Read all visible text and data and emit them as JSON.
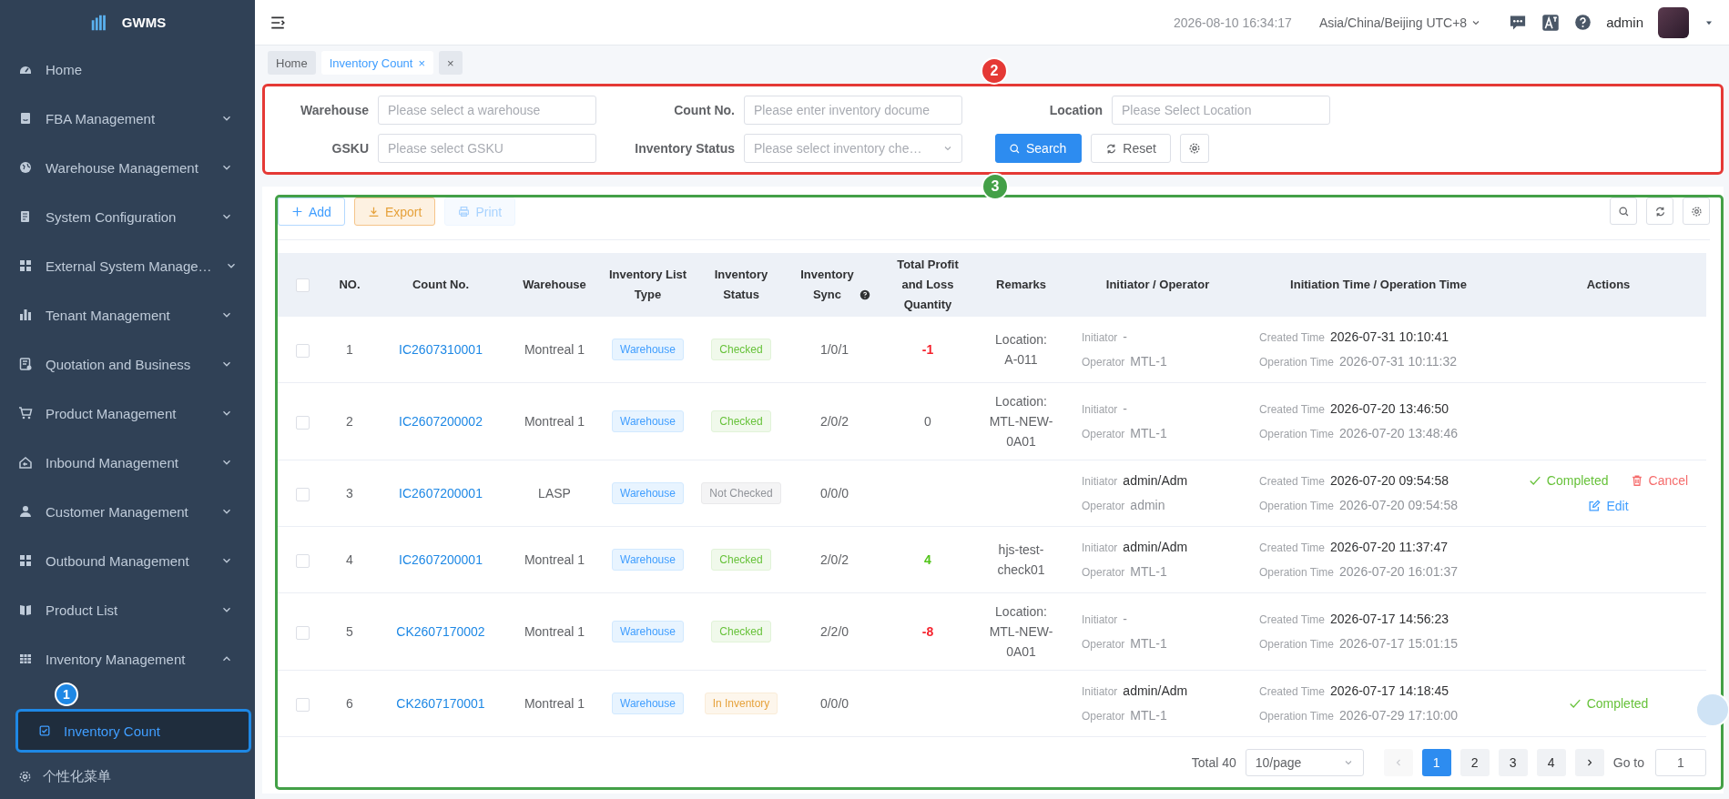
{
  "sidebar": {
    "logo": "GWMS",
    "items": [
      {
        "label": "Home",
        "kind": "link"
      },
      {
        "label": "FBA Management",
        "kind": "submenu",
        "expanded": false
      },
      {
        "label": "Warehouse Management",
        "kind": "submenu",
        "expanded": false
      },
      {
        "label": "System Configuration",
        "kind": "submenu",
        "expanded": false
      },
      {
        "label": "External System Manage…",
        "kind": "submenu",
        "expanded": false
      },
      {
        "label": "Tenant Management",
        "kind": "submenu",
        "expanded": false
      },
      {
        "label": "Quotation and Business",
        "kind": "submenu",
        "expanded": false
      },
      {
        "label": "Product Management",
        "kind": "submenu",
        "expanded": false
      },
      {
        "label": "Inbound Management",
        "kind": "submenu",
        "expanded": false
      },
      {
        "label": "Customer Management",
        "kind": "submenu",
        "expanded": false
      },
      {
        "label": "Outbound Management",
        "kind": "submenu",
        "expanded": false
      },
      {
        "label": "Product List",
        "kind": "submenu",
        "expanded": false
      },
      {
        "label": "Inventory Management",
        "kind": "submenu",
        "expanded": true,
        "children": [
          {
            "label": "Inventory Count",
            "selected": true
          }
        ]
      }
    ],
    "footer": "个性化菜单"
  },
  "header": {
    "datetime": "2026-08-10 16:34:17",
    "timezone": "Asia/China/Beijing UTC+8",
    "user": "admin"
  },
  "tabs": [
    {
      "label": "Home",
      "selected": false,
      "closable": false
    },
    {
      "label": "Inventory Count",
      "selected": true,
      "closable": true
    }
  ],
  "close_all": "×",
  "filters": [
    {
      "label": "Warehouse",
      "kind": "input",
      "placeholder": "Please select a warehouse"
    },
    {
      "label": "Count No.",
      "kind": "input",
      "placeholder": "Please enter inventory docume"
    },
    {
      "label": "Location",
      "kind": "input",
      "placeholder": "Please Select Location"
    },
    {
      "label": "GSKU",
      "kind": "input",
      "placeholder": "Please select GSKU"
    },
    {
      "label": "Inventory Status",
      "kind": "select",
      "placeholder": "Please select inventory che…"
    }
  ],
  "filter_buttons": [
    {
      "label": "Search",
      "kind": "primary"
    },
    {
      "label": "Reset",
      "kind": "default"
    }
  ],
  "toolbar": [
    {
      "label": "Add",
      "kind": "add",
      "disabled": false
    },
    {
      "label": "Export",
      "kind": "export",
      "disabled": false
    },
    {
      "label": "Print",
      "kind": "print",
      "disabled": true
    }
  ],
  "table": {
    "select_all": {
      "checked": false
    },
    "columns": [
      {
        "label": "NO.",
        "kind": "text"
      },
      {
        "label": "Count No.",
        "kind": "text"
      },
      {
        "label": "Warehouse",
        "kind": "text"
      },
      {
        "label": "Inventory List Type",
        "kind": "text"
      },
      {
        "label": "Inventory Status",
        "kind": "text"
      },
      {
        "label": "Inventory Sync",
        "kind": "help"
      },
      {
        "label": "Total Profit and Loss Quantity",
        "kind": "text"
      },
      {
        "label": "Remarks",
        "kind": "text"
      },
      {
        "label": "Initiator / Operator",
        "kind": "text"
      },
      {
        "label": "Initiation Time / Operation Time",
        "kind": "text"
      },
      {
        "label": "Actions",
        "kind": "text"
      }
    ],
    "rows": [
      {
        "checked": false,
        "no": "1",
        "count_no": "IC2607310001",
        "warehouse": "Montreal 1",
        "list_type": "Warehouse",
        "status": {
          "label": "Checked",
          "kind": "checked"
        },
        "sync": "1/0/1",
        "total": {
          "value": "-1",
          "kind": "loss"
        },
        "remarks": "Location: A-011",
        "initiator_label": "Initiator",
        "initiator": "-",
        "operator_label": "Operator",
        "operator": "MTL-1",
        "created_label": "Created Time",
        "created": "2026-07-31 10:10:41",
        "operated_label": "Operation Time",
        "operated": "2026-07-31 10:11:32",
        "actions": []
      },
      {
        "checked": false,
        "no": "2",
        "count_no": "IC2607200002",
        "warehouse": "Montreal 1",
        "list_type": "Warehouse",
        "status": {
          "label": "Checked",
          "kind": "checked"
        },
        "sync": "2/0/2",
        "total": {
          "value": "0",
          "kind": "neutral"
        },
        "remarks": "Location: MTL-NEW-0A01",
        "initiator_label": "Initiator",
        "initiator": "-",
        "operator_label": "Operator",
        "operator": "MTL-1",
        "created_label": "Created Time",
        "created": "2026-07-20 13:46:50",
        "operated_label": "Operation Time",
        "operated": "2026-07-20 13:48:46",
        "actions": []
      },
      {
        "checked": false,
        "no": "3",
        "count_no": "IC2607200001",
        "warehouse": "LASP",
        "list_type": "Warehouse",
        "status": {
          "label": "Not Checked",
          "kind": "not_checked"
        },
        "sync": "0/0/0",
        "initiator_label": "Initiator",
        "initiator": "admin/Adm",
        "operator_label": "Operator",
        "operator": "admin",
        "created_label": "Created Time",
        "created": "2026-07-20 09:54:58",
        "operated_label": "Operation Time",
        "operated": "2026-07-20 09:54:58",
        "actions": [
          {
            "label": "Completed",
            "kind": "complete"
          },
          {
            "label": "Cancel",
            "kind": "cancel"
          },
          {
            "label": "Edit",
            "kind": "edit"
          }
        ]
      },
      {
        "checked": false,
        "no": "4",
        "count_no": "IC2607200001",
        "warehouse": "Montreal 1",
        "list_type": "Warehouse",
        "status": {
          "label": "Checked",
          "kind": "checked"
        },
        "sync": "2/0/2",
        "total": {
          "value": "4",
          "kind": "gain"
        },
        "remarks": "hjs-test-check01",
        "initiator_label": "Initiator",
        "initiator": "admin/Adm",
        "operator_label": "Operator",
        "operator": "MTL-1",
        "created_label": "Created Time",
        "created": "2026-07-20 11:37:47",
        "operated_label": "Operation Time",
        "operated": "2026-07-20 16:01:37",
        "actions": []
      },
      {
        "checked": false,
        "no": "5",
        "count_no": "CK2607170002",
        "warehouse": "Montreal 1",
        "list_type": "Warehouse",
        "status": {
          "label": "Checked",
          "kind": "checked"
        },
        "sync": "2/2/0",
        "total": {
          "value": "-8",
          "kind": "loss"
        },
        "remarks": "Location: MTL-NEW-0A01",
        "initiator_label": "Initiator",
        "initiator": "-",
        "operator_label": "Operator",
        "operator": "MTL-1",
        "created_label": "Created Time",
        "created": "2026-07-17 14:56:23",
        "operated_label": "Operation Time",
        "operated": "2026-07-17 15:01:15",
        "actions": []
      },
      {
        "checked": false,
        "no": "6",
        "count_no": "CK2607170001",
        "warehouse": "Montreal 1",
        "list_type": "Warehouse",
        "status": {
          "label": "In Inventory",
          "kind": "in_inventory"
        },
        "sync": "0/0/0",
        "initiator_label": "Initiator",
        "initiator": "admin/Adm",
        "operator_label": "Operator",
        "operator": "MTL-1",
        "created_label": "Created Time",
        "created": "2026-07-17 14:18:45",
        "operated_label": "Operation Time",
        "operated": "2026-07-29 17:10:00",
        "actions": [
          {
            "label": "Completed",
            "kind": "complete"
          }
        ]
      }
    ]
  },
  "pagination": {
    "total": "Total 40",
    "page_size": "10/page",
    "pages": [
      {
        "label": "1",
        "selected": true
      },
      {
        "label": "2",
        "selected": false
      },
      {
        "label": "3",
        "selected": false
      },
      {
        "label": "4",
        "selected": false
      }
    ],
    "goto_label": "Go to",
    "goto_value": "1"
  },
  "annotations": [
    {
      "label": "1",
      "color": "#1e88e5"
    },
    {
      "label": "2",
      "color": "#e53935"
    },
    {
      "label": "3",
      "color": "#43a047"
    }
  ]
}
